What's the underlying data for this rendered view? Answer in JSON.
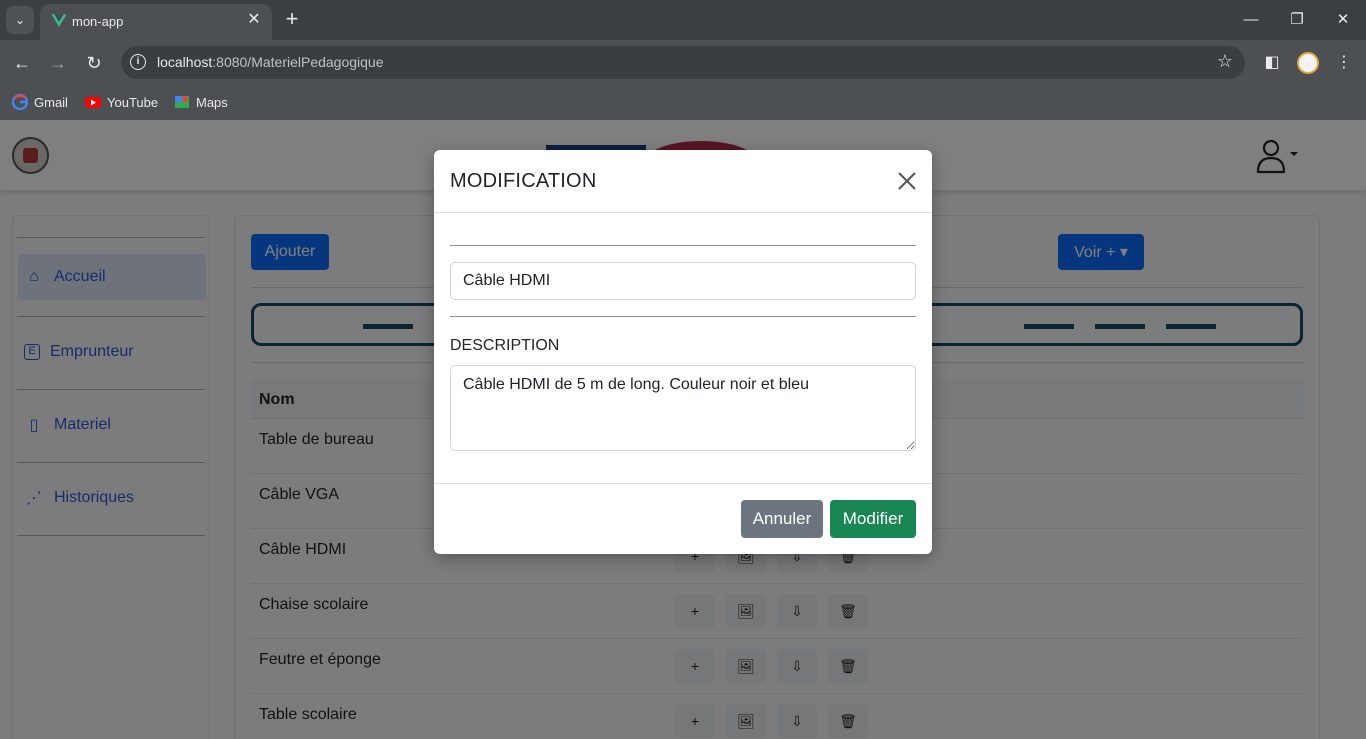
{
  "browser": {
    "tab_title": "mon-app",
    "url_host": "localhost",
    "url_rest": ":8080/MaterielPedagogique",
    "bookmarks": [
      {
        "label": "Gmail",
        "icon": "google-icon"
      },
      {
        "label": "YouTube",
        "icon": "youtube-icon"
      },
      {
        "label": "Maps",
        "icon": "maps-icon"
      }
    ]
  },
  "sidebar": {
    "items": [
      {
        "label": "Accueil",
        "icon": "home-icon",
        "glyph": "⌂"
      },
      {
        "label": "Emprunteur",
        "icon": "borrower-icon",
        "glyph": "E"
      },
      {
        "label": "Materiel",
        "icon": "clipboard-icon",
        "glyph": "▯"
      },
      {
        "label": "Historiques",
        "icon": "hierarchy-icon",
        "glyph": "⋰"
      }
    ]
  },
  "content": {
    "add_label": "Ajouter",
    "voir_label": "Voir +",
    "table_header": "Nom",
    "rows": [
      "Table de bureau",
      "Câble VGA",
      "Câble HDMI",
      "Chaise scolaire",
      "Feutre et éponge",
      "Table scolaire"
    ],
    "row_actions": [
      "+",
      "🖼",
      "⇩",
      "🗑"
    ]
  },
  "modal": {
    "title": "MODIFICATION",
    "name_value": "Câble HDMI",
    "description_label": "DESCRIPTION",
    "description_value": "Câble HDMI de 5 m de long. Couleur noir et bleu",
    "cancel_label": "Annuler",
    "submit_label": "Modifier"
  },
  "colors": {
    "primary": "#0d6efd",
    "secondary": "#6c757d",
    "success": "#198754",
    "filter_border": "#134b5f",
    "sidebar_link": "#2a5bd7"
  }
}
